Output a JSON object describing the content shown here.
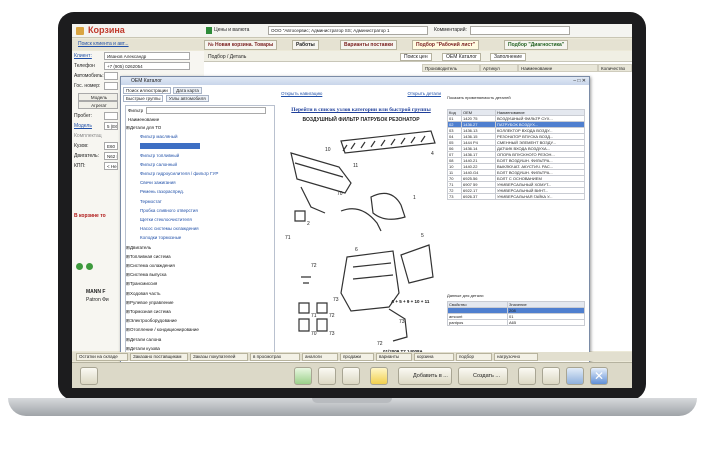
{
  "app": {
    "title": "Корзина",
    "prices_label": "Цены и валюта",
    "org_field": "ООО \"Автосервис; Администратор SS; Администратор 1",
    "comment_label": "Комментарий:"
  },
  "tabs": [
    {
      "label": "№ Новая корзина. Товары"
    },
    {
      "label": "Работы"
    },
    {
      "label": "Варианты поставки"
    },
    {
      "label": "Подбор \"Рабочий лист\""
    },
    {
      "label": "Подбор \"Диагностика\""
    }
  ],
  "left": {
    "search_client": "Поиск клиента и авт...",
    "history": "История обращ...",
    "client_label": "Клиент:",
    "client_value": "Иванов Александр",
    "phone_label": "Телефон",
    "phone_value": "+7 (905) 0262054",
    "car_label": "Автомобиль:",
    "plate_label": "Гос. номер:",
    "model_label": "Модель",
    "aggregate_label": "Агрегат",
    "mileage_label": "Пробег:",
    "model_link": "Модель",
    "model_value": "5 (E60",
    "complect_label": "Комплектац",
    "body_label": "Кузов:",
    "body_value": "E60",
    "engine_label": "Двигатель:",
    "engine_value": "N62 B",
    "kpp_label": "КПП:",
    "kpp_value": "< Не",
    "cart_notice": "В корзине то",
    "brand_row1": "MANN F",
    "brand_row2": "Patron  Фи"
  },
  "right": {
    "search_caption": "Подбор / Деталь",
    "search_prices": "Поиск цен",
    "oem_catalog": "OEM Каталог",
    "fill": "Заполнение",
    "col_producer": "Производитель",
    "col_article": "Артикул",
    "col_name": "Наименование",
    "col_qty": "Количество"
  },
  "dialog": {
    "title": "OEM Каталог",
    "tabs": [
      "Поиск иллюстрации",
      "Дата карта"
    ],
    "subtabs": [
      "Быстрые группы",
      "Узлы автомобиля"
    ],
    "filter_label": "Фильтр",
    "tree_header": "Наименование",
    "tree": [
      {
        "label": "Детали для ТО",
        "type": "group"
      },
      {
        "label": "Фильтр масляный",
        "type": "link"
      },
      {
        "label": "",
        "type": "selected"
      },
      {
        "label": "Фильтр топливный",
        "type": "link"
      },
      {
        "label": "Фильтр салонный",
        "type": "link"
      },
      {
        "label": "Фильтр гидроусилителя / фильтр ГУР",
        "type": "link"
      },
      {
        "label": "Свечи зажигания",
        "type": "link"
      },
      {
        "label": "Ремень газораспред.",
        "type": "link"
      },
      {
        "label": "Термостат",
        "type": "link"
      },
      {
        "label": "Пробка сливного отверстия",
        "type": "link"
      },
      {
        "label": "Щетки стеклоочистителя",
        "type": "link"
      },
      {
        "label": "Насос системы охлаждения",
        "type": "link"
      },
      {
        "label": "Колодки тормозные",
        "type": "link"
      },
      {
        "label": "Двигатель",
        "type": "group"
      },
      {
        "label": "Топливная система",
        "type": "group"
      },
      {
        "label": "Система охлаждения",
        "type": "group"
      },
      {
        "label": "Система выпуска",
        "type": "group"
      },
      {
        "label": "Трансмиссия",
        "type": "group"
      },
      {
        "label": "Ходовая часть",
        "type": "group"
      },
      {
        "label": "Рулевое управление",
        "type": "group"
      },
      {
        "label": "Тормозная система",
        "type": "group"
      },
      {
        "label": "Электрооборудование",
        "type": "group"
      },
      {
        "label": "Отопление / кондиционирование",
        "type": "group"
      },
      {
        "label": "Детали салона",
        "type": "group"
      },
      {
        "label": "Детали кузова",
        "type": "group"
      }
    ],
    "diagram": {
      "back_link": "Открыть навигацию",
      "details_link": "Открыть детали",
      "heading": "Перейти в список узлов категории или быстрой группы",
      "subtitle": "ВОЗДУШНЫЙ ФИЛЬТР ПАТРУБОК РЕЗОНАТОР",
      "formula": "A + 5 + 9 + 10 + 11",
      "footer": "01/2009   T7 14008A"
    },
    "parts": {
      "caption": "Показать применяемость деталей",
      "headers": [
        "Код",
        "OEM",
        "Наименование"
      ],
      "rows": [
        [
          "01",
          "1420 75",
          "ВОЗДУШНЫЙ ФИЛЬТР СУХ..."
        ],
        [
          "02",
          "1436.27",
          "ПАТРУБОК ВОЗДУХ..."
        ],
        [
          "03",
          "1436.13",
          "КОЛЛЕКТОР ВХОДА ВОЗДУ..."
        ],
        [
          "04",
          "1436.15",
          "РЕЗОНАТОР ВПУСКА ВОЗД..."
        ],
        [
          "05",
          "1444 P4",
          "СМЕННЫЙ ЭЛЕМЕНТ ВОЗДУ..."
        ],
        [
          "06",
          "1436.14",
          "ДАТЧИК ВХОДА ВОЗДУХА..."
        ],
        [
          "07",
          "1436.17",
          "ОПОРА ВПУСКНОГО РЕЗОН..."
        ],
        [
          "08",
          "1440.21",
          "БОЛТ ВОЗДУШН. ФИЛЬТРА..."
        ],
        [
          "10",
          "1440.22",
          "ВЫКЛЮЧАТ. АКУСТИЧ. РАС..."
        ],
        [
          "11",
          "1440.G4",
          "БОЛТ ВОЗДУШН. ФИЛЬТРА..."
        ],
        [
          "70",
          "6925.56",
          "БОЛТ С ОСНОВАНИЕМ"
        ],
        [
          "71",
          "6907 59",
          "УНИВЕРСАЛЬНЫЙ ХОМУТ..."
        ],
        [
          "72",
          "6922.17",
          "УНИВЕРСАЛЬНЫЙ ВИНТ..."
        ],
        [
          "73",
          "6926.37",
          "УНИВЕРСАЛЬНАЯ ГАЙКА У..."
        ]
      ],
      "hl_index": 1,
      "supply_caption": "Данные для детали",
      "supply_headers": [
        "Свойство",
        "Значение"
      ],
      "supply_rows": [
        [
          "",
          "208"
        ],
        [
          "amount",
          "01"
        ],
        [
          "pantpos",
          "A65"
        ]
      ]
    }
  },
  "bottom_tabs": [
    "Остатки на складе",
    "Заказано поставщикам",
    "Заказы покупателей",
    "в просмотрах",
    "аналоги",
    "продажи",
    "варианты",
    "корзина",
    "подбор",
    "нагрузочно"
  ],
  "toolbar": {
    "add_label": "Добавить в ...",
    "create_label": "Создать ..."
  }
}
